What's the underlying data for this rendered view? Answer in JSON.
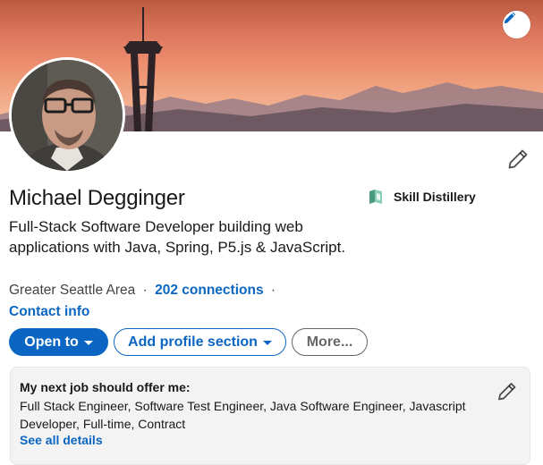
{
  "profile": {
    "name": "Michael Degginger",
    "headline": "Full-Stack Software Developer building web applications with Java, Spring, P5.js & JavaScript.",
    "location": "Greater Seattle Area",
    "connections": "202 connections",
    "separator": "·",
    "contact_info": "Contact info",
    "company": "Skill Distillery"
  },
  "actions": {
    "open_to": "Open to",
    "add_section": "Add profile section",
    "more": "More..."
  },
  "open_to_work": {
    "title": "My next job should offer me:",
    "details": "Full Stack Engineer, Software Test Engineer, Java Software Engineer, Javascript Developer, Full-time, Contract",
    "see_all": "See all details"
  },
  "colors": {
    "primary": "#0a66c2",
    "card_bg": "#f3f3f3"
  },
  "icons": {
    "banner_edit": "pencil-icon",
    "profile_edit": "pencil-icon",
    "company_logo": "skill-distillery-logo-icon",
    "card_edit": "pencil-icon"
  }
}
